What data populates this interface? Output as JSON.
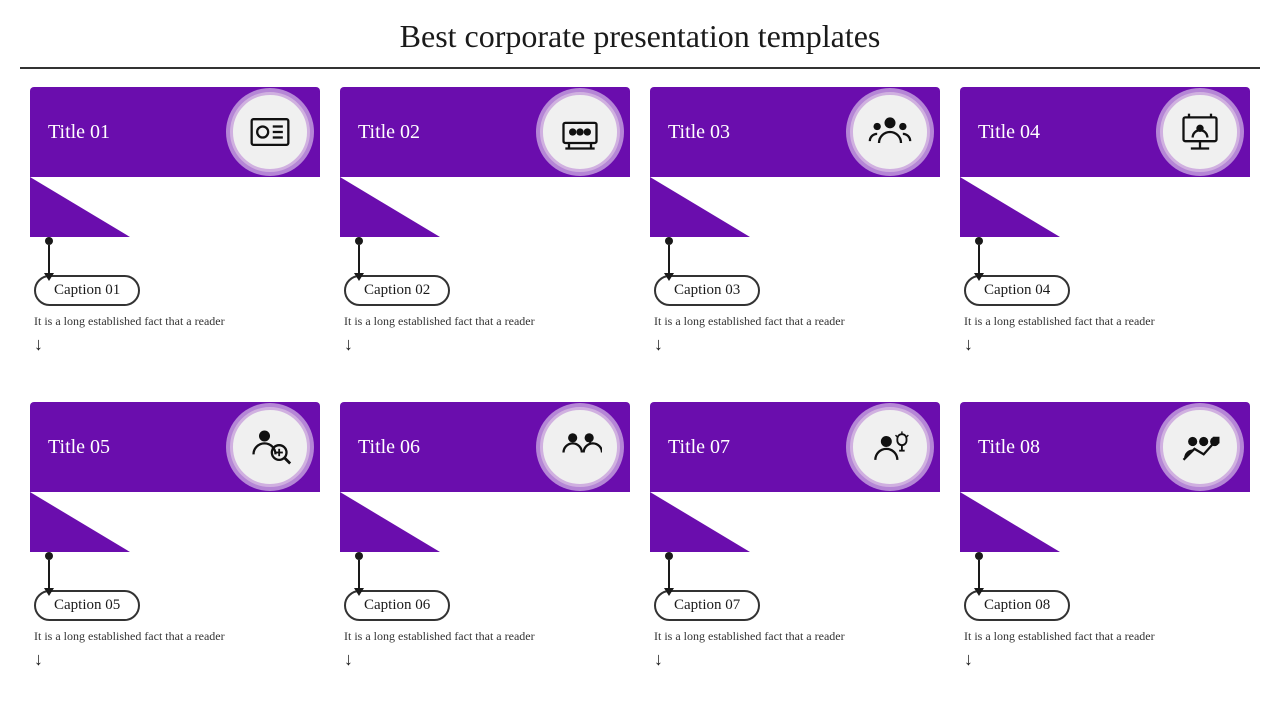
{
  "page": {
    "title": "Best corporate presentation templates"
  },
  "cards": [
    {
      "id": "card-01",
      "title": "Title 01",
      "caption": "Caption 01",
      "body": "It is a long established  fact that a reader",
      "icon": "id-card"
    },
    {
      "id": "card-02",
      "title": "Title 02",
      "caption": "Caption 02",
      "body": "It is a long established  fact that a reader",
      "icon": "meeting"
    },
    {
      "id": "card-03",
      "title": "Title 03",
      "caption": "Caption 03",
      "body": "It is a long established  fact that a reader",
      "icon": "group"
    },
    {
      "id": "card-04",
      "title": "Title 04",
      "caption": "Caption 04",
      "body": "It is a long established  fact that a reader",
      "icon": "presentation"
    },
    {
      "id": "card-05",
      "title": "Title 05",
      "caption": "Caption 05",
      "body": "It is a long established  fact that a reader",
      "icon": "search-person"
    },
    {
      "id": "card-06",
      "title": "Title 06",
      "caption": "Caption 06",
      "body": "It is a long established  fact that a reader",
      "icon": "question-group"
    },
    {
      "id": "card-07",
      "title": "Title 07",
      "caption": "Caption 07",
      "body": "It is a long established  fact that a reader",
      "icon": "idea-person"
    },
    {
      "id": "card-08",
      "title": "Title 08",
      "caption": "Caption 08",
      "body": "It is a long established  fact that a reader",
      "icon": "growth"
    }
  ],
  "colors": {
    "purple": "#6a0dad",
    "light_purple_border": "#d0b0e0"
  }
}
